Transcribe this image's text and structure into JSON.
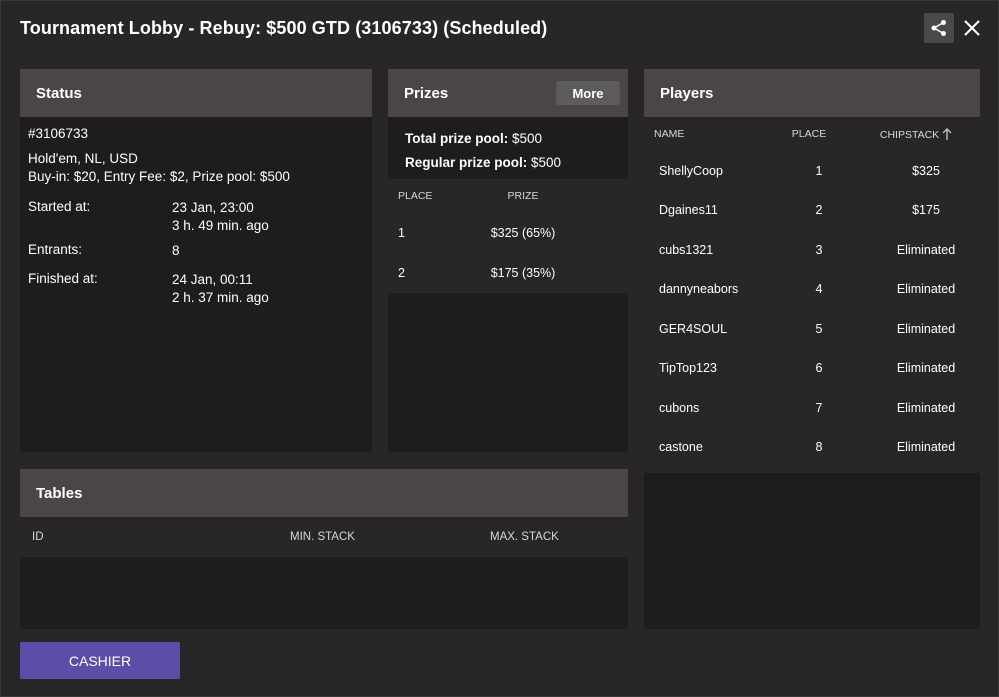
{
  "window": {
    "title": "Tournament Lobby - Rebuy: $500 GTD (3106733) (Scheduled)"
  },
  "status": {
    "header": "Status",
    "id": "#3106733",
    "game": "Hold'em, NL, USD",
    "buyin": "Buy-in: $20, Entry Fee: $2, Prize pool: $500",
    "started_label": "Started at:",
    "started_value": "23 Jan, 23:00",
    "started_ago": "3 h. 49 min. ago",
    "entrants_label": "Entrants:",
    "entrants_value": "8",
    "finished_label": "Finished at:",
    "finished_value": "24 Jan, 00:11",
    "finished_ago": "2 h. 37 min. ago"
  },
  "prizes": {
    "header": "Prizes",
    "more_label": "More",
    "total_label": "Total prize pool:",
    "total_value": "$500",
    "regular_label": "Regular prize pool:",
    "regular_value": "$500",
    "col_place": "PLACE",
    "col_prize": "PRIZE",
    "rows": [
      {
        "place": "1",
        "prize": "$325 (65%)"
      },
      {
        "place": "2",
        "prize": "$175 (35%)"
      }
    ]
  },
  "players": {
    "header": "Players",
    "col_name": "NAME",
    "col_place": "PLACE",
    "col_chipstack": "CHIPSTACK",
    "rows": [
      {
        "name": "ShellyCoop",
        "place": "1",
        "chips": "$325"
      },
      {
        "name": "Dgaines11",
        "place": "2",
        "chips": "$175"
      },
      {
        "name": "cubs1321",
        "place": "3",
        "chips": "Eliminated"
      },
      {
        "name": "dannyneabors",
        "place": "4",
        "chips": "Eliminated"
      },
      {
        "name": "GER4SOUL",
        "place": "5",
        "chips": "Eliminated"
      },
      {
        "name": "TipTop123",
        "place": "6",
        "chips": "Eliminated"
      },
      {
        "name": "cubons",
        "place": "7",
        "chips": "Eliminated"
      },
      {
        "name": "castone",
        "place": "8",
        "chips": "Eliminated"
      }
    ]
  },
  "tables": {
    "header": "Tables",
    "col_id": "ID",
    "col_min": "MIN. STACK",
    "col_max": "MAX. STACK"
  },
  "footer": {
    "cashier_label": "CASHIER"
  },
  "icons": {
    "share": "share-icon",
    "close": "close-icon",
    "sort": "arrow-up-icon"
  },
  "colors": {
    "background": "#282627",
    "panel": "#1e1c1d",
    "panel_header": "#4a4647",
    "accent": "#5c4ea8"
  }
}
